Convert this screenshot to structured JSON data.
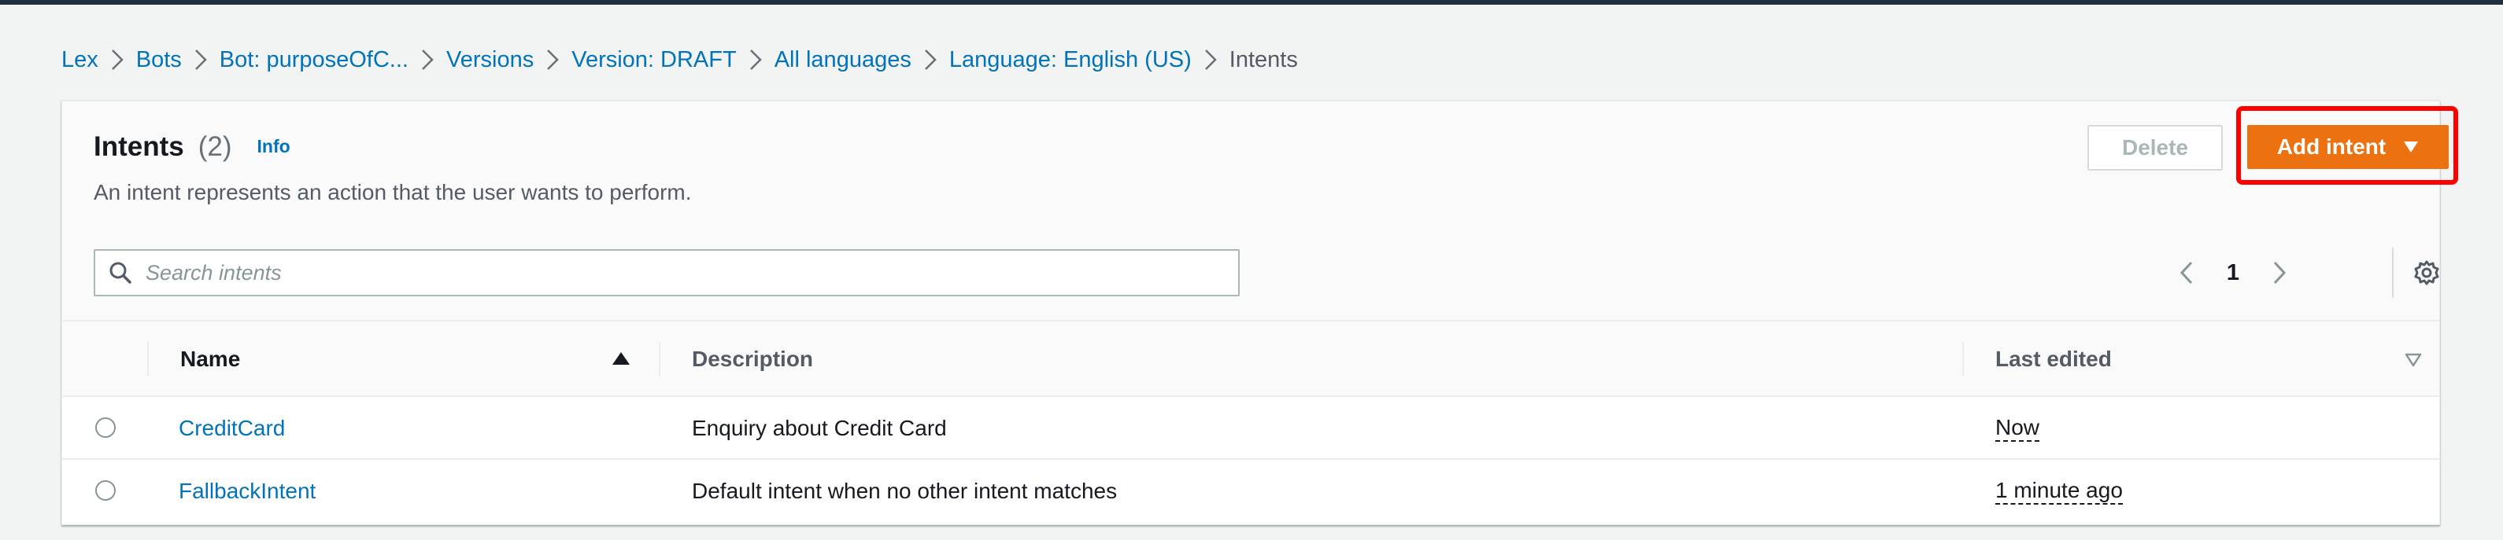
{
  "breadcrumb": [
    {
      "label": "Lex"
    },
    {
      "label": "Bots"
    },
    {
      "label": "Bot: purposeOfC..."
    },
    {
      "label": "Versions"
    },
    {
      "label": "Version: DRAFT"
    },
    {
      "label": "All languages"
    },
    {
      "label": "Language: English (US)"
    },
    {
      "label": "Intents"
    }
  ],
  "panel": {
    "title": "Intents",
    "count": "(2)",
    "info_label": "Info",
    "description": "An intent represents an action that the user wants to perform.",
    "delete_label": "Delete",
    "add_intent_label": "Add intent"
  },
  "search": {
    "placeholder": "Search intents",
    "value": ""
  },
  "pagination": {
    "current_page": "1"
  },
  "table": {
    "columns": [
      "Name",
      "Description",
      "Last edited"
    ],
    "sort_column": "Name",
    "sort_direction": "ascending",
    "rows": [
      {
        "name": "CreditCard",
        "description": "Enquiry about Credit Card",
        "last_edited": "Now"
      },
      {
        "name": "FallbackIntent",
        "description": "Default intent when no other intent matches",
        "last_edited": "1 minute ago"
      }
    ]
  },
  "colors": {
    "link": "#0073bb",
    "primary_button": "#ec7211",
    "highlight_box": "#ff0000",
    "disabled_text": "#aab7b8"
  }
}
